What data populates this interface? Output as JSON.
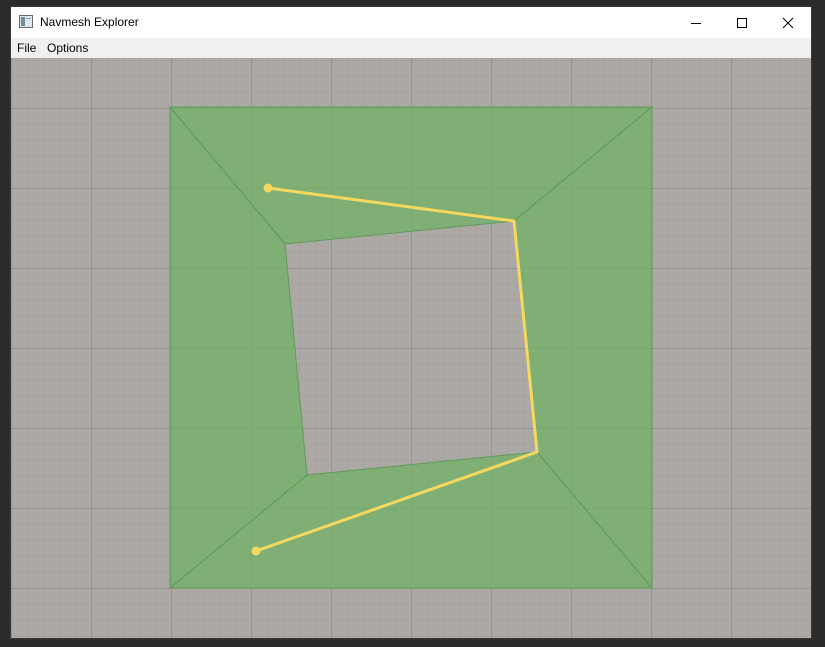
{
  "window": {
    "title": "Navmesh Explorer",
    "app_icon": "window-app-icon",
    "controls": {
      "minimize_icon": "minimize-icon",
      "maximize_icon": "maximize-icon",
      "close_icon": "close-icon"
    }
  },
  "menu": {
    "items": [
      {
        "label": "File"
      },
      {
        "label": "Options"
      }
    ]
  },
  "viewport": {
    "background_color": "#aca8a5",
    "navmesh_fill_color": "#84b87e",
    "path_color": "#f5d85e",
    "path_point_count": 4
  }
}
